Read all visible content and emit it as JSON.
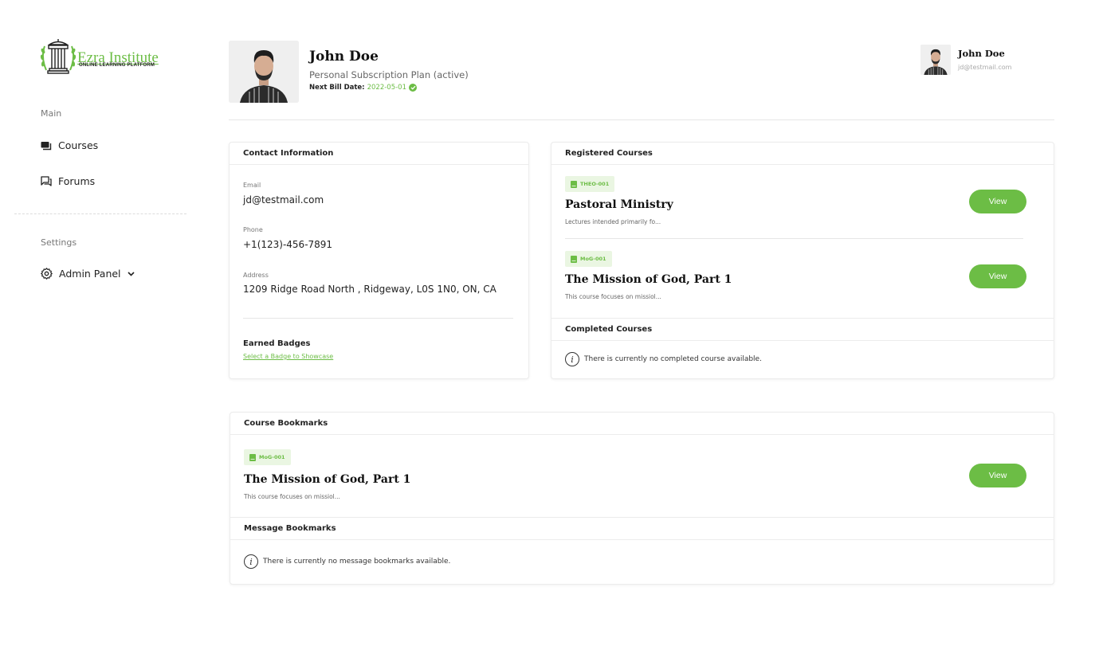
{
  "brand": {
    "name": "Ezra Institute",
    "tagline": "ONLINE LEARNING PLATFORM",
    "accent_color": "#6cbd45"
  },
  "sidebar": {
    "main_label": "Main",
    "items": [
      {
        "label": "Courses",
        "icon": "courses-icon"
      },
      {
        "label": "Forums",
        "icon": "forums-icon"
      }
    ],
    "settings_label": "Settings",
    "admin": {
      "label": "Admin Panel",
      "icon": "gear-icon"
    }
  },
  "profile": {
    "name": "John Doe",
    "plan": "Personal Subscription Plan (active)",
    "bill_label": "Next Bill Date:",
    "bill_date": "2022-05-01"
  },
  "user_menu": {
    "name": "John Doe",
    "email": "jd@testmail.com"
  },
  "contact": {
    "title": "Contact Information",
    "email_label": "Email",
    "email": "jd@testmail.com",
    "phone_label": "Phone",
    "phone": "+1(123)-456-7891",
    "address_label": "Address",
    "address": "1209 Ridge Road North , Ridgeway, L0S 1N0, ON, CA",
    "badges_title": "Earned Badges",
    "badges_link": "Select a Badge to Showcase"
  },
  "registered": {
    "title": "Registered Courses",
    "courses": [
      {
        "code": "THEO-001",
        "title": "Pastoral Ministry",
        "desc": "Lectures intended primarily fo...",
        "action": "View"
      },
      {
        "code": "MoG-001",
        "title": "The Mission of God, Part 1",
        "desc": "This course focuses on missiol...",
        "action": "View"
      }
    ]
  },
  "completed": {
    "title": "Completed Courses",
    "empty": "There is currently no completed course available."
  },
  "course_bookmarks": {
    "title": "Course Bookmarks",
    "courses": [
      {
        "code": "MoG-001",
        "title": "The Mission of God, Part 1",
        "desc": "This course focuses on missiol...",
        "action": "View"
      }
    ]
  },
  "message_bookmarks": {
    "title": "Message Bookmarks",
    "empty": "There is currently no message bookmarks available."
  }
}
